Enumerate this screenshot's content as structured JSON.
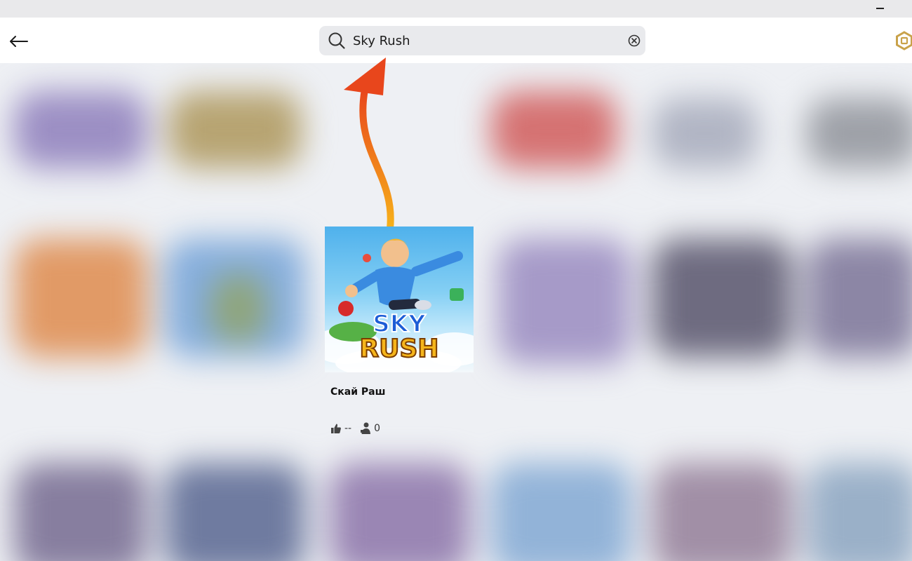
{
  "window": {
    "minimize_icon": "minimize-icon"
  },
  "header": {
    "back_icon": "arrow-left-icon",
    "search": {
      "value": "Sky Rush",
      "search_icon": "search-icon",
      "clear_icon": "clear-circle-x-icon"
    },
    "robux_icon": "robux-hexagon-icon"
  },
  "result": {
    "thumbnail_logo_line1": "SKY",
    "thumbnail_logo_line2": "RUSH",
    "title": "Скай Раш",
    "likes_icon": "thumbs-up-icon",
    "likes": "--",
    "players_icon": "players-icon",
    "players": "0"
  },
  "colors": {
    "accent_arrow_top": "#e8461c",
    "accent_arrow_bottom": "#f7b21a",
    "header_bg": "#ffffff",
    "search_bg": "#e9eaed",
    "robux_gold": "#c9a24a"
  }
}
